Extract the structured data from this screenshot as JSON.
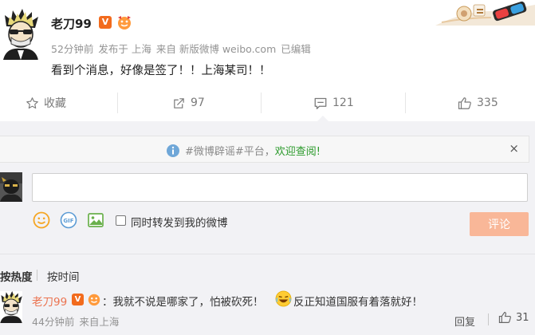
{
  "post": {
    "author": "老刀99",
    "verified_badge": "V",
    "meta": {
      "time": "52分钟前",
      "location": "发布于 上海",
      "source": "来自 新版微博 weibo.com",
      "edited": "已编辑"
    },
    "text": "看到个消息，好像是签了！！上海某司！！"
  },
  "actions": {
    "favorite_label": "收藏",
    "repost_count": "97",
    "comment_count": "121",
    "like_count": "335"
  },
  "notice": {
    "prefix": "#微博辟谣#平台，",
    "link": "欢迎查阅!",
    "close": "×"
  },
  "composer": {
    "input_value": "",
    "forward_label": "同时转发到我的微博",
    "submit_label": "评论",
    "gif_label": "GIF"
  },
  "sort": {
    "hot_label": "按热度",
    "time_label": "按时间"
  },
  "comment": {
    "author": "老刀99",
    "verified_badge": "V",
    "text_part1": "：我就不说是哪家了，怕被砍死！",
    "text_part2": "反正知道国服有着落就好！",
    "time": "44分钟前",
    "source": "来自上海",
    "reply_label": "回复",
    "like_count": "31"
  },
  "colors": {
    "accent_orange": "#eb7350",
    "verified_orange": "#f26b1d",
    "submit_disabled": "#f9b798",
    "notice_link": "#2a9a2a"
  }
}
